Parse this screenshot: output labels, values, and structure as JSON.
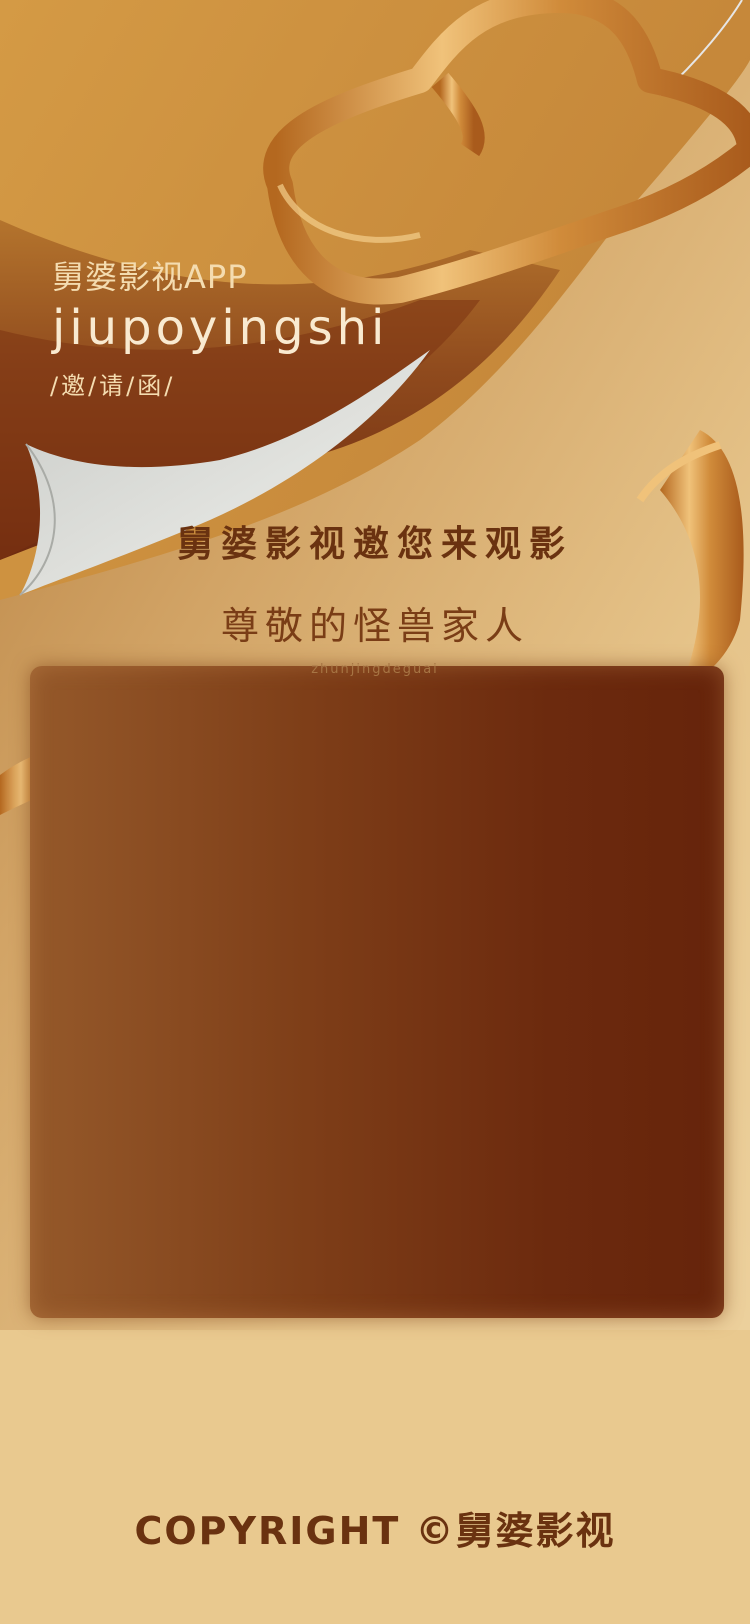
{
  "brand": {
    "title": "舅婆影视APP",
    "roman": "jiupoyingshi",
    "subtitle": "/邀/请/函/"
  },
  "invitation": {
    "headline": "舅婆影视邀您来观影",
    "greeting": "尊敬的怪兽家人",
    "greeting_roman": "zhunjingdeguai"
  },
  "footer": {
    "copyright": "COPYRIGHT ©舅婆影视"
  },
  "colors": {
    "background": "#e9c98f",
    "brown_dark": "#6a3210",
    "ribbon_gold": "#d59a49",
    "paper_grey": "#d9d9d6"
  }
}
